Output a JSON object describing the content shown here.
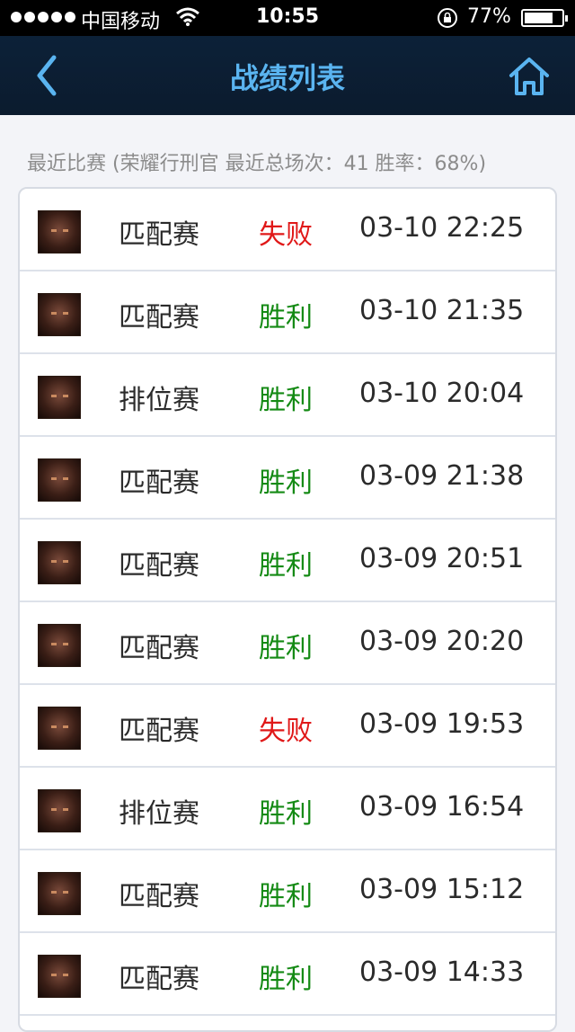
{
  "status_bar": {
    "carrier": "中国移动",
    "time": "10:55",
    "battery_percent": "77%",
    "battery_level": 0.77
  },
  "header": {
    "title": "战绩列表",
    "back_icon": "chevron-left-icon",
    "home_icon": "home-icon",
    "accent_color": "#5ab4f0"
  },
  "summary": {
    "text": "最近比赛 (荣耀行刑官 最近总场次：41 胜率：68%)"
  },
  "colors": {
    "win": "#148a14",
    "lose": "#e01818"
  },
  "matches": [
    {
      "type": "匹配赛",
      "result": "失败",
      "outcome": "lose",
      "time": "03-10 22:25"
    },
    {
      "type": "匹配赛",
      "result": "胜利",
      "outcome": "win",
      "time": "03-10 21:35"
    },
    {
      "type": "排位赛",
      "result": "胜利",
      "outcome": "win",
      "time": "03-10 20:04"
    },
    {
      "type": "匹配赛",
      "result": "胜利",
      "outcome": "win",
      "time": "03-09 21:38"
    },
    {
      "type": "匹配赛",
      "result": "胜利",
      "outcome": "win",
      "time": "03-09 20:51"
    },
    {
      "type": "匹配赛",
      "result": "胜利",
      "outcome": "win",
      "time": "03-09 20:20"
    },
    {
      "type": "匹配赛",
      "result": "失败",
      "outcome": "lose",
      "time": "03-09 19:53"
    },
    {
      "type": "排位赛",
      "result": "胜利",
      "outcome": "win",
      "time": "03-09 16:54"
    },
    {
      "type": "匹配赛",
      "result": "胜利",
      "outcome": "win",
      "time": "03-09 15:12"
    },
    {
      "type": "匹配赛",
      "result": "胜利",
      "outcome": "win",
      "time": "03-09 14:33"
    }
  ]
}
